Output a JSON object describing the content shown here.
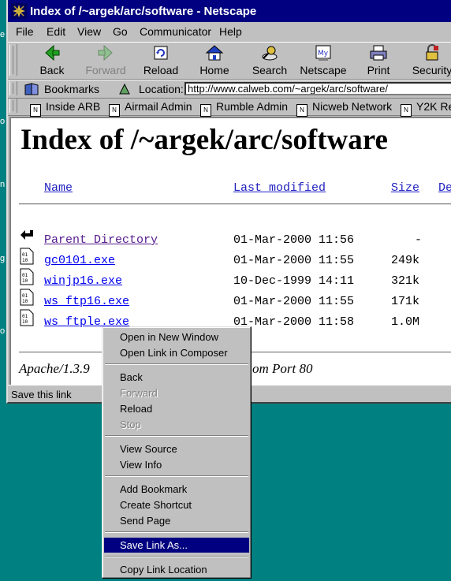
{
  "window": {
    "title": "Index of /~argek/arc/software - Netscape"
  },
  "menu": [
    "File",
    "Edit",
    "View",
    "Go",
    "Communicator",
    "Help"
  ],
  "toolbar": {
    "back": "Back",
    "forward": "Forward",
    "reload": "Reload",
    "home": "Home",
    "search": "Search",
    "netscape": "Netscape",
    "print": "Print",
    "security": "Security"
  },
  "location": {
    "bookmarks": "Bookmarks",
    "label": "Location:",
    "url": "http://www.calweb.com/~argek/arc/software/"
  },
  "personal_toolbar": [
    "Inside ARB",
    "Airmail Admin",
    "Rumble Admin",
    "Nicweb Network",
    "Y2K Re"
  ],
  "page": {
    "heading": "Index of /~argek/arc/software",
    "columns": [
      "Name",
      "Last modified",
      "Size",
      "De"
    ],
    "rows": [
      {
        "name": "Parent Directory",
        "modified": "01-Mar-2000 11:56",
        "size": "-"
      },
      {
        "name": "gc0101.exe",
        "modified": "01-Mar-2000 11:55",
        "size": "249k"
      },
      {
        "name": "winjp16.exe",
        "modified": "10-Dec-1999 14:11",
        "size": "321k"
      },
      {
        "name": "ws_ftp16.exe",
        "modified": "01-Mar-2000 11:55",
        "size": "171k"
      },
      {
        "name": "ws_ftple.exe",
        "modified": "01-Mar-2000 11:58",
        "size": "1.0M"
      }
    ],
    "address_left": "Apache/1.3.9",
    "address_right": "om Port 80"
  },
  "status": "Save this link",
  "context_menu": {
    "open_new_window": "Open in New Window",
    "open_composer": "Open Link in Composer",
    "back": "Back",
    "forward": "Forward",
    "reload": "Reload",
    "stop": "Stop",
    "view_source": "View Source",
    "view_info": "View Info",
    "add_bookmark": "Add Bookmark",
    "create_shortcut": "Create Shortcut",
    "send_page": "Send Page",
    "save_link_as": "Save Link As...",
    "copy_link_location": "Copy Link Location"
  },
  "colors": {
    "desktop": "#008080",
    "titlebar": "#000080",
    "highlight": "#000080",
    "chrome": "#c0c0c0"
  }
}
